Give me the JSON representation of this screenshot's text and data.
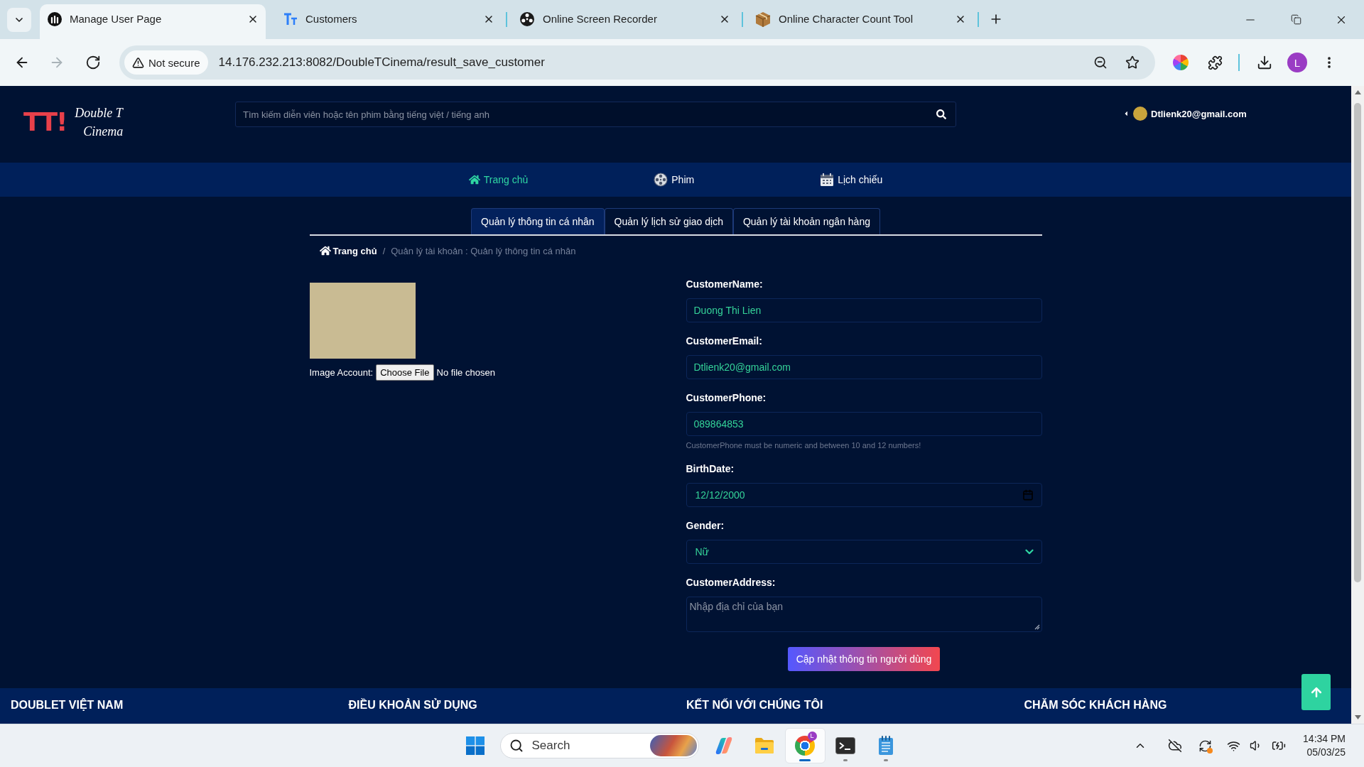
{
  "browser": {
    "tabs": [
      {
        "title": "Manage User Page",
        "kind": "round",
        "selected": true
      },
      {
        "title": "Customers",
        "kind": "text",
        "selected": false
      },
      {
        "title": "Online Screen Recorder",
        "kind": "reel",
        "selected": false
      },
      {
        "title": "Online Character Count Tool",
        "kind": "box",
        "selected": false
      }
    ],
    "nav_buttons": [
      {
        "kind": "back",
        "disabled": false
      },
      {
        "kind": "forward",
        "disabled": true
      },
      {
        "kind": "reload",
        "disabled": false
      }
    ],
    "address_bar": {
      "security": "Not secure",
      "url": "14.176.232.213:8082/DoubleTCinema/result_save_customer"
    },
    "profile": "L"
  },
  "header": {
    "logo": {
      "mark": "TT!",
      "line1": "Double T",
      "line2": "Cinema"
    },
    "search": {
      "placeholder": "Tìm kiếm diễn viên hoặc tên phim bằng tiếng việt / tiếng anh"
    },
    "user": "Dtlienk20@gmail.com"
  },
  "nav": [
    {
      "kind": "home",
      "label": "Trang chủ",
      "selected": true
    },
    {
      "kind": "film",
      "label": "Phim",
      "selected": false
    },
    {
      "kind": "schedule",
      "label": "Lịch chiếu",
      "selected": false
    }
  ],
  "account_tabs": [
    {
      "label": "Quản lý thông tin cá nhân",
      "selected": true
    },
    {
      "label": "Quản lý lịch sử giao dịch",
      "selected": false
    },
    {
      "label": "Quản lý tài khoản ngân hàng",
      "selected": false
    }
  ],
  "breadcrumb": {
    "home": "Trang chủ",
    "separator": "/",
    "current": "Quản lý tài khoản : Quản lý thông tin cá nhân"
  },
  "image_account": {
    "label": "Image Account:",
    "button": "Choose File",
    "status": "No file chosen"
  },
  "form": {
    "fields": [
      {
        "label": "CustomerName:",
        "kind": "text",
        "value": "Duong Thi Lien"
      },
      {
        "label": "CustomerEmail:",
        "kind": "text",
        "value": "Dtlienk20@gmail.com"
      },
      {
        "label": "CustomerPhone:",
        "kind": "text",
        "value": "089864853",
        "hint": "CustomerPhone must be numeric and between 10 and 12 numbers!"
      },
      {
        "label": "BirthDate:",
        "kind": "date",
        "value": "12/12/2000"
      },
      {
        "label": "Gender:",
        "kind": "select",
        "value": "Nữ"
      },
      {
        "label": "CustomerAddress:",
        "kind": "textarea",
        "placeholder": "Nhập địa chỉ của bạn"
      }
    ],
    "submit": "Cập nhật thông tin người dùng"
  },
  "footer": {
    "headings": [
      "DOUBLET VIỆT NAM",
      "ĐIỀU KHOẢN SỬ DỤNG",
      "KẾT NỐI VỚI CHÚNG TÔI",
      "CHĂM SÓC KHÁCH HÀNG"
    ]
  },
  "taskbar": {
    "search": {
      "placeholder": "Search"
    },
    "apps": [
      {
        "kind": "copilot",
        "selected": false,
        "running": false
      },
      {
        "kind": "folder",
        "selected": false,
        "running": false
      },
      {
        "kind": "browser",
        "selected": true,
        "running": true,
        "badge": "L"
      },
      {
        "kind": "terminal",
        "selected": false,
        "running": true
      },
      {
        "kind": "notepad",
        "selected": false,
        "running": true
      }
    ],
    "clock": {
      "time": "14:34 PM",
      "date": "05/03/25"
    }
  }
}
